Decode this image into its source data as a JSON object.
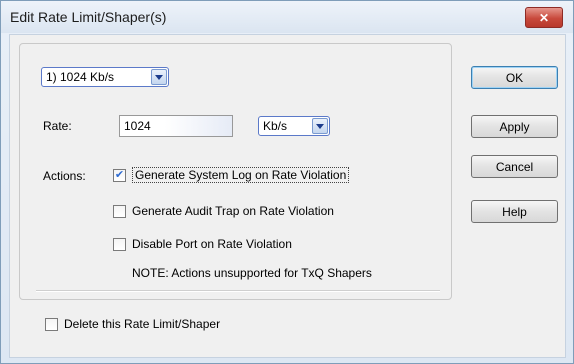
{
  "window": {
    "title": "Edit Rate Limit/Shaper(s)",
    "close_glyph": "✕"
  },
  "selector": {
    "value": "1) 1024 Kb/s"
  },
  "rate": {
    "label": "Rate:",
    "value": "1024",
    "unit": "Kb/s"
  },
  "actions": {
    "label": "Actions:",
    "items": [
      {
        "label": "Generate System Log on Rate Violation",
        "checked": true
      },
      {
        "label": "Generate Audit Trap on Rate Violation",
        "checked": false
      },
      {
        "label": "Disable Port on Rate Violation",
        "checked": false
      }
    ],
    "note": "NOTE: Actions unsupported for TxQ Shapers"
  },
  "delete": {
    "label": "Delete this Rate Limit/Shaper",
    "checked": false
  },
  "buttons": {
    "ok": "OK",
    "apply": "Apply",
    "cancel": "Cancel",
    "help": "Help"
  },
  "colors": {
    "accent": "#5b79c9",
    "close": "#c8493c",
    "check": "#2e6bd1"
  }
}
